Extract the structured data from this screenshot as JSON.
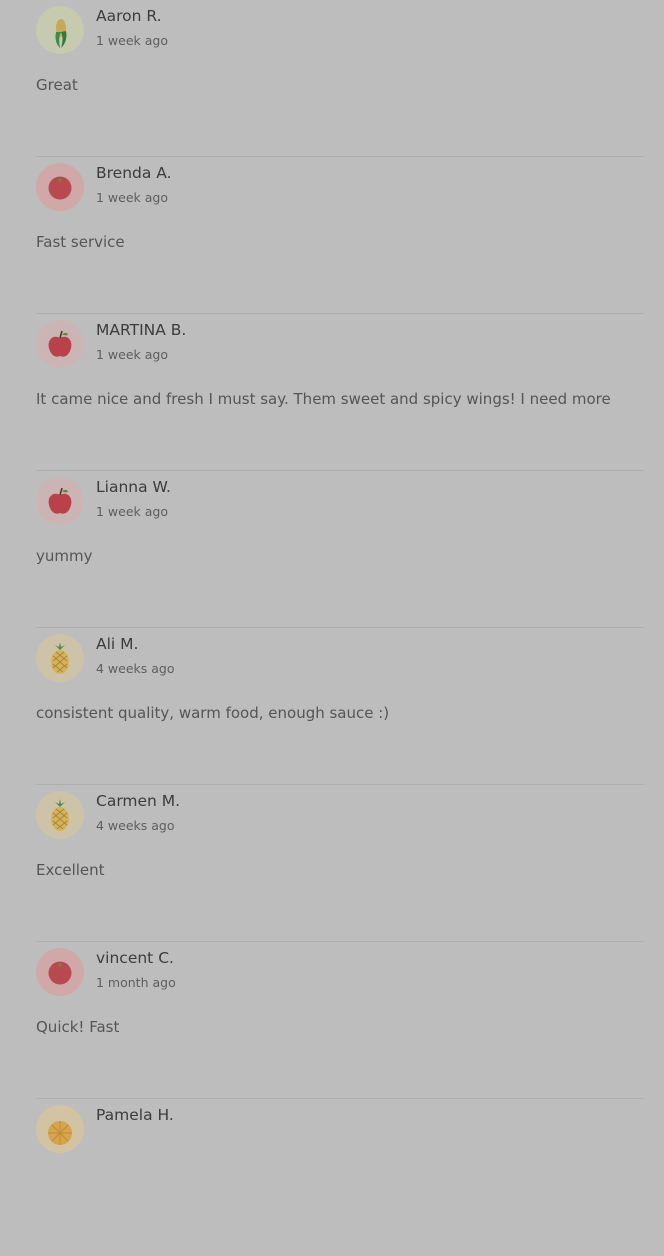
{
  "reviews": [
    {
      "name": "Aaron R.",
      "time": "1 week ago",
      "text": "Great",
      "avatar": "corn-icon"
    },
    {
      "name": "Brenda A.",
      "time": "1 week ago",
      "text": "Fast service",
      "avatar": "tomato-icon"
    },
    {
      "name": "MARTINA B.",
      "time": "1 week ago",
      "text": "It came nice and fresh I must say. Them sweet and spicy wings! I need more",
      "avatar": "apple-icon"
    },
    {
      "name": "Lianna W.",
      "time": "1 week ago",
      "text": "yummy",
      "avatar": "apple-icon"
    },
    {
      "name": "Ali M.",
      "time": "4 weeks ago",
      "text": "consistent quality, warm food, enough sauce :)",
      "avatar": "pineapple-icon"
    },
    {
      "name": "Carmen M.",
      "time": "4 weeks ago",
      "text": "Excellent",
      "avatar": "pineapple-icon"
    },
    {
      "name": "vincent C.",
      "time": "1 month ago",
      "text": "Quick! Fast",
      "avatar": "tomato-icon"
    },
    {
      "name": "Pamela H.",
      "time": "",
      "text": "",
      "avatar": "orange-icon"
    }
  ]
}
